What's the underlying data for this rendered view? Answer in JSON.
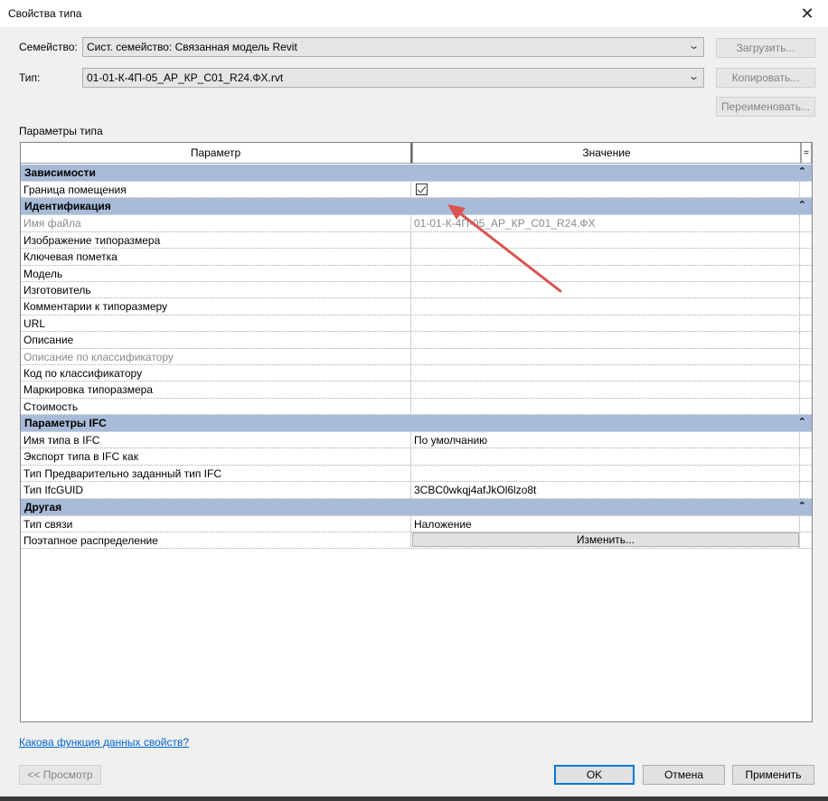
{
  "window": {
    "title": "Свойства типа",
    "close_glyph": "✕"
  },
  "family": {
    "label": "Семейство:",
    "value": "Сист. семейство: Связанная модель Revit",
    "load_button": "Загрузить..."
  },
  "type": {
    "label": "Тип:",
    "value": "01-01-К-4П-05_АР_КР_С01_R24.ФХ.rvt",
    "copy_button": "Копировать...",
    "rename_button": "Переименовать..."
  },
  "section_label": "Параметры типа",
  "grid": {
    "header": {
      "param": "Параметр",
      "value": "Значение",
      "expand": "="
    },
    "groups": [
      {
        "title": "Зависимости",
        "rows": [
          {
            "key": "Граница помещения",
            "value": "",
            "checkbox": true,
            "checked": true
          }
        ]
      },
      {
        "title": "Идентификация",
        "rows": [
          {
            "key": "Имя файла",
            "value": "01-01-К-4П-05_АР_КР_С01_R24.ФХ",
            "disabled": true
          },
          {
            "key": "Изображение типоразмера",
            "value": ""
          },
          {
            "key": "Ключевая пометка",
            "value": ""
          },
          {
            "key": "Модель",
            "value": ""
          },
          {
            "key": "Изготовитель",
            "value": ""
          },
          {
            "key": "Комментарии к типоразмеру",
            "value": ""
          },
          {
            "key": "URL",
            "value": ""
          },
          {
            "key": "Описание",
            "value": ""
          },
          {
            "key": "Описание по классификатору",
            "value": "",
            "disabled": true
          },
          {
            "key": "Код по классификатору",
            "value": ""
          },
          {
            "key": "Маркировка типоразмера",
            "value": ""
          },
          {
            "key": "Стоимость",
            "value": ""
          }
        ]
      },
      {
        "title": "Параметры IFC",
        "rows": [
          {
            "key": "Имя типа в IFC",
            "value": "По умолчанию"
          },
          {
            "key": "Экспорт типа в IFC как",
            "value": ""
          },
          {
            "key": "Тип Предварительно заданный тип IFC",
            "value": ""
          },
          {
            "key": "Тип IfcGUID",
            "value": "3CBC0wkqj4afJkOl6lzo8t"
          }
        ]
      },
      {
        "title": "Другая",
        "rows": [
          {
            "key": "Тип связи",
            "value": "Наложение"
          },
          {
            "key": "Поэтапное распределение",
            "value": "",
            "button": "Изменить..."
          }
        ]
      }
    ],
    "collapse_glyph": "⌃"
  },
  "help_link": "Какова функция данных свойств?",
  "footer": {
    "preview_button": "<< Просмотр",
    "ok_button": "OK",
    "cancel_button": "Отмена",
    "apply_button": "Применить"
  },
  "colors": {
    "group_header": "#a8bbd8",
    "annotation_arrow": "#d9534f",
    "link": "#0066cc",
    "default_button_border": "#0078d7"
  }
}
